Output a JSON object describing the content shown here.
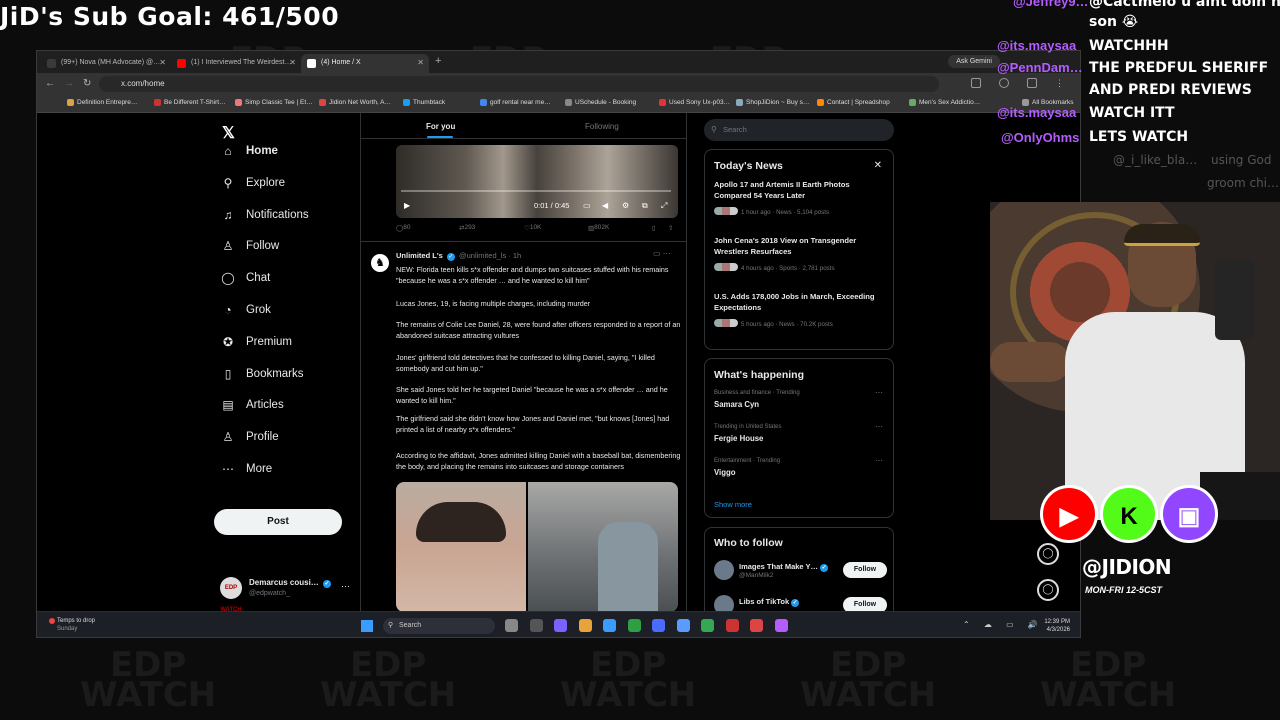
{
  "overlay": {
    "sub_goal": "JiD's Sub Goal: 461/500",
    "watermark": "EDP\nWATCH",
    "handle": "@JIDION",
    "schedule": "MON-FRI 12-5CST"
  },
  "browser": {
    "tabs": [
      {
        "label": "(99+) Nova (MH Advocate) @…",
        "favicon_color": "#3a3a3a"
      },
      {
        "label": "(1) I Interviewed The Weirdest…",
        "favicon_color": "#ff0000"
      },
      {
        "label": "(4) Home / X",
        "favicon_color": "#ffffff"
      }
    ],
    "ask_gemini": "Ask Gemini",
    "url": "x.com/home",
    "bookmarks": [
      {
        "label": "Definition Entrepre…",
        "color": "#d9a441"
      },
      {
        "label": "Be Different T-Shirt…",
        "color": "#c33"
      },
      {
        "label": "Simp Classic Tee | Et…",
        "color": "#e77"
      },
      {
        "label": "Jidion Net Worth, A…",
        "color": "#d44"
      },
      {
        "label": "Thumbtack",
        "color": "#1d9bf0"
      },
      {
        "label": "golf rental near me…",
        "color": "#4285f4"
      },
      {
        "label": "USchedule - Booking",
        "color": "#888"
      },
      {
        "label": "Used Sony Ux-p03…",
        "color": "#e53238"
      },
      {
        "label": "ShopJiDion ~ Buy s…",
        "color": "#8ab"
      },
      {
        "label": "Contact | Spreadshop",
        "color": "#f80"
      },
      {
        "label": "Men's Sex Addictio…",
        "color": "#6a6"
      },
      {
        "label": "All Bookmarks",
        "color": "#999"
      }
    ]
  },
  "x": {
    "nav": [
      {
        "label": "Home",
        "icon": "home-icon",
        "glyph": "⌂",
        "name": "home"
      },
      {
        "label": "Explore",
        "icon": "search-icon",
        "glyph": "⚲",
        "name": "explore"
      },
      {
        "label": "Notifications",
        "icon": "bell-icon",
        "glyph": "♫",
        "name": "notifications"
      },
      {
        "label": "Follow",
        "icon": "person-plus-icon",
        "glyph": "♙",
        "name": "follow"
      },
      {
        "label": "Chat",
        "icon": "chat-icon",
        "glyph": "◯",
        "name": "chat"
      },
      {
        "label": "Grok",
        "icon": "grok-icon",
        "glyph": "◔",
        "name": "grok"
      },
      {
        "label": "Premium",
        "icon": "premium-icon",
        "glyph": "✪",
        "name": "premium"
      },
      {
        "label": "Bookmarks",
        "icon": "bookmark-icon",
        "glyph": "▯",
        "name": "bookmarks"
      },
      {
        "label": "Articles",
        "icon": "articles-icon",
        "glyph": "▤",
        "name": "articles"
      },
      {
        "label": "Profile",
        "icon": "profile-icon",
        "glyph": "♙",
        "name": "profile"
      },
      {
        "label": "More",
        "icon": "more-icon",
        "glyph": "⋯",
        "name": "more"
      }
    ],
    "post_button": "Post",
    "account": {
      "avatar": "EDP WATCH",
      "name": "Demarcus cousi…",
      "handle": "@edpwatch_"
    },
    "tabs": {
      "for_you": "For you",
      "following": "Following"
    },
    "video": {
      "time": "0:01 / 0:45"
    },
    "prev_stats": {
      "replies": "80",
      "reposts": "293",
      "likes": "10K",
      "views": "802K"
    },
    "tweet": {
      "name": "Unlimited L's",
      "handle": "@unlimited_ls",
      "time": "· 1h",
      "paragraphs": [
        "NEW: Florida teen kills s*x offender and dumps two suitcases stuffed with his remains \"because he was a s*x offender … and he wanted to kill him\"",
        "Lucas Jones, 19, is facing multiple charges, including murder",
        "The remains of Colie Lee Daniel, 28, were found after officers responded to a report of an abandoned suitcase attracting vultures",
        "Jones' girlfriend told detectives that he confessed to killing Daniel, saying, \"I killed somebody and cut him up.\"",
        "She said Jones told her he targeted Daniel \"because he was a s*x offender … and he wanted to kill him.\"",
        "The girlfriend said she didn't know how Jones and Daniel met, \"but knows [Jones] had printed a list of nearby s*x offenders.\"",
        "According to the affidavit, Jones admitted killing Daniel with a baseball bat, dismembering the body, and placing the remains into suitcases and storage containers"
      ]
    },
    "search_placeholder": "Search",
    "news": {
      "title": "Today's News",
      "items": [
        {
          "title": "Apollo 17 and Artemis II Earth Photos Compared 54 Years Later",
          "meta": "1 hour ago · News · 5,104 posts"
        },
        {
          "title": "John Cena's 2018 View on Transgender Wrestlers Resurfaces",
          "meta": "4 hours ago · Sports · 2,781 posts"
        },
        {
          "title": "U.S. Adds 178,000 Jobs in March, Exceeding Expectations",
          "meta": "5 hours ago · News · 70.2K posts"
        }
      ]
    },
    "happening": {
      "title": "What's happening",
      "items": [
        {
          "category": "Business and finance · Trending",
          "name": "Samara Cyn"
        },
        {
          "category": "Trending in United States",
          "name": "Fergie House"
        },
        {
          "category": "Entertainment · Trending",
          "name": "Viggo"
        }
      ],
      "show_more": "Show more"
    },
    "who_to_follow": {
      "title": "Who to follow",
      "items": [
        {
          "name": "Images That Make Y…",
          "handle": "@ManMilk2",
          "button": "Follow"
        },
        {
          "name": "Libs of TikTok",
          "handle": "",
          "button": "Follow"
        }
      ]
    }
  },
  "taskbar": {
    "weather_title": "Temps to drop",
    "weather_sub": "Sunday",
    "search": "Search",
    "time": "12:39 PM",
    "date": "4/3/2026"
  },
  "chat": {
    "lines": [
      {
        "text": "@Jeffrey9…",
        "kind": "user"
      },
      {
        "text": "@Cactmelo u aint doin nthn",
        "kind": "line"
      },
      {
        "text": "son 😭",
        "kind": "line"
      },
      {
        "text": "@its.maysaa",
        "kind": "user"
      },
      {
        "text": "WATCHHH",
        "kind": "line"
      },
      {
        "text": "@PennDam…",
        "kind": "user"
      },
      {
        "text": "THE PREDFUL SHERIFF",
        "kind": "line"
      },
      {
        "text": "AND PREDI REVIEWS",
        "kind": "line"
      },
      {
        "text": "@its.maysaa",
        "kind": "user"
      },
      {
        "text": "WATCH ITT",
        "kind": "line"
      },
      {
        "text": "LETS WATCH",
        "kind": "line"
      },
      {
        "text": "@OnlyOhms",
        "kind": "user"
      },
      {
        "text": "@_i_like_bla…",
        "kind": "faded"
      },
      {
        "text": "using God",
        "kind": "faded"
      },
      {
        "text": "groom chi…",
        "kind": "faded"
      }
    ]
  }
}
